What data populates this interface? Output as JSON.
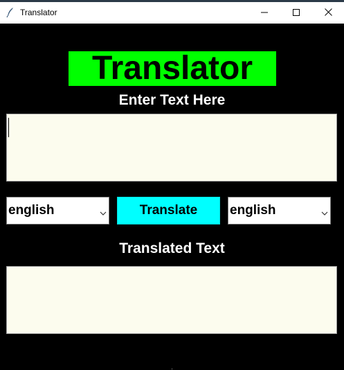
{
  "window": {
    "title": "Translator",
    "app_icon": "feather-icon",
    "controls": [
      "minimize-icon",
      "maximize-icon",
      "close-icon"
    ]
  },
  "header": {
    "title": "Translator",
    "background_color": "#00ff00"
  },
  "input_section": {
    "label": "Enter Text Here",
    "value": ""
  },
  "controls": {
    "source_language": "english",
    "translate_label": "Translate",
    "translate_color": "#00ffff",
    "target_language": "english",
    "dropdown_icon": "chevron-down-icon"
  },
  "output_section": {
    "label": "Translated Text",
    "value": ""
  },
  "colors": {
    "background": "#000000",
    "textbox": "#fcfcee"
  }
}
